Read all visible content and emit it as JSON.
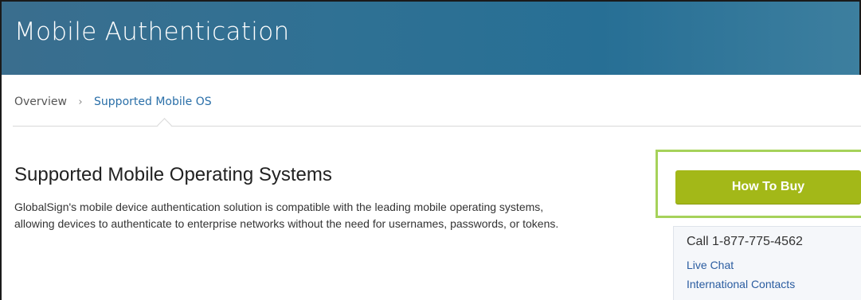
{
  "header": {
    "title": "Mobile Authentication"
  },
  "breadcrumb": {
    "overview": "Overview",
    "separator": "›",
    "current": "Supported Mobile OS"
  },
  "main": {
    "heading": "Supported Mobile Operating Systems",
    "description": "GlobalSign's mobile device authentication solution is compatible with the leading mobile operating systems, allowing devices to authenticate to enterprise networks without the need for usernames, passwords, or tokens."
  },
  "sidebar": {
    "buy_label": "How To Buy",
    "phone": "Call 1-877-775-4562",
    "live_chat": "Live Chat",
    "international": "International Contacts"
  },
  "colors": {
    "header_bg": "#2f7194",
    "link": "#2a6fa8",
    "buy_button": "#a3b818",
    "buy_border": "#a6d25a"
  }
}
